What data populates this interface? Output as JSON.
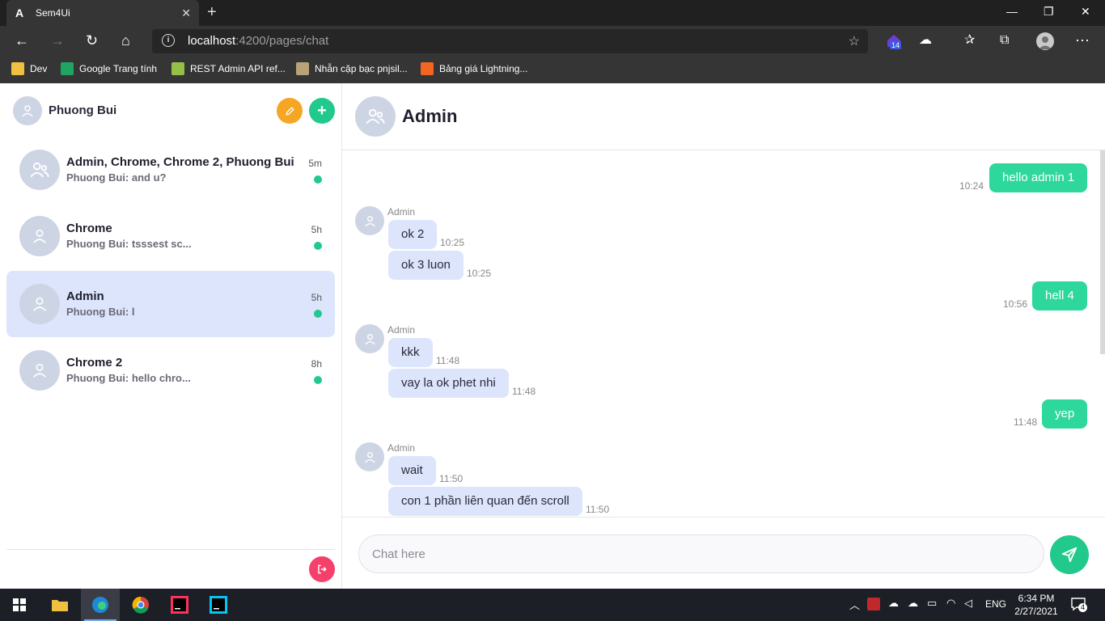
{
  "browser": {
    "tab_title": "Sem4Ui",
    "url_host": "localhost",
    "url_path": ":4200/pages/chat",
    "extension_badge": "14",
    "bookmarks": [
      {
        "label": "Dev",
        "color": "#f0c040"
      },
      {
        "label": "Google Trang tính",
        "color": "#1fa463"
      },
      {
        "label": "REST Admin API ref...",
        "color": "#95bf47"
      },
      {
        "label": "Nhẫn cặp bạc pnjsil...",
        "color": "#b9a27a"
      },
      {
        "label": "Bảng giá Lightning...",
        "color": "#f26522"
      }
    ]
  },
  "sidebar": {
    "user_name": "Phuong Bui",
    "conversations": [
      {
        "name": "Admin, Chrome, Chrome 2, Phuong Bui",
        "preview": "Phuong Bui: and u?",
        "time": "5m",
        "group": true
      },
      {
        "name": "Chrome",
        "preview": "Phuong Bui: tsssest sc...",
        "time": "5h",
        "group": false
      },
      {
        "name": "Admin",
        "preview": "Phuong Bui: l",
        "time": "5h",
        "group": false,
        "active": true
      },
      {
        "name": "Chrome 2",
        "preview": "Phuong Bui: hello chro...",
        "time": "8h",
        "group": false
      }
    ]
  },
  "chat": {
    "title": "Admin",
    "messages": [
      {
        "from": "me",
        "text": "hello admin 1",
        "time": "10:24"
      },
      {
        "from": "Admin",
        "text": "ok 2",
        "time": "10:25"
      },
      {
        "from": "Admin",
        "text": "ok 3 luon",
        "time": "10:25"
      },
      {
        "from": "me",
        "text": "hell 4",
        "time": "10:56"
      },
      {
        "from": "Admin",
        "text": "kkk",
        "time": "11:48"
      },
      {
        "from": "Admin",
        "text": "vay la ok phet nhi",
        "time": "11:48"
      },
      {
        "from": "me",
        "text": "yep",
        "time": "11:48"
      },
      {
        "from": "Admin",
        "text": "wait",
        "time": "11:50"
      },
      {
        "from": "Admin",
        "text": "con 1 phần liên quan đến scroll",
        "time": "11:50"
      }
    ],
    "input_placeholder": "Chat here"
  },
  "taskbar": {
    "language": "ENG",
    "time": "6:34 PM",
    "date": "2/27/2021",
    "notification_count": "4"
  }
}
